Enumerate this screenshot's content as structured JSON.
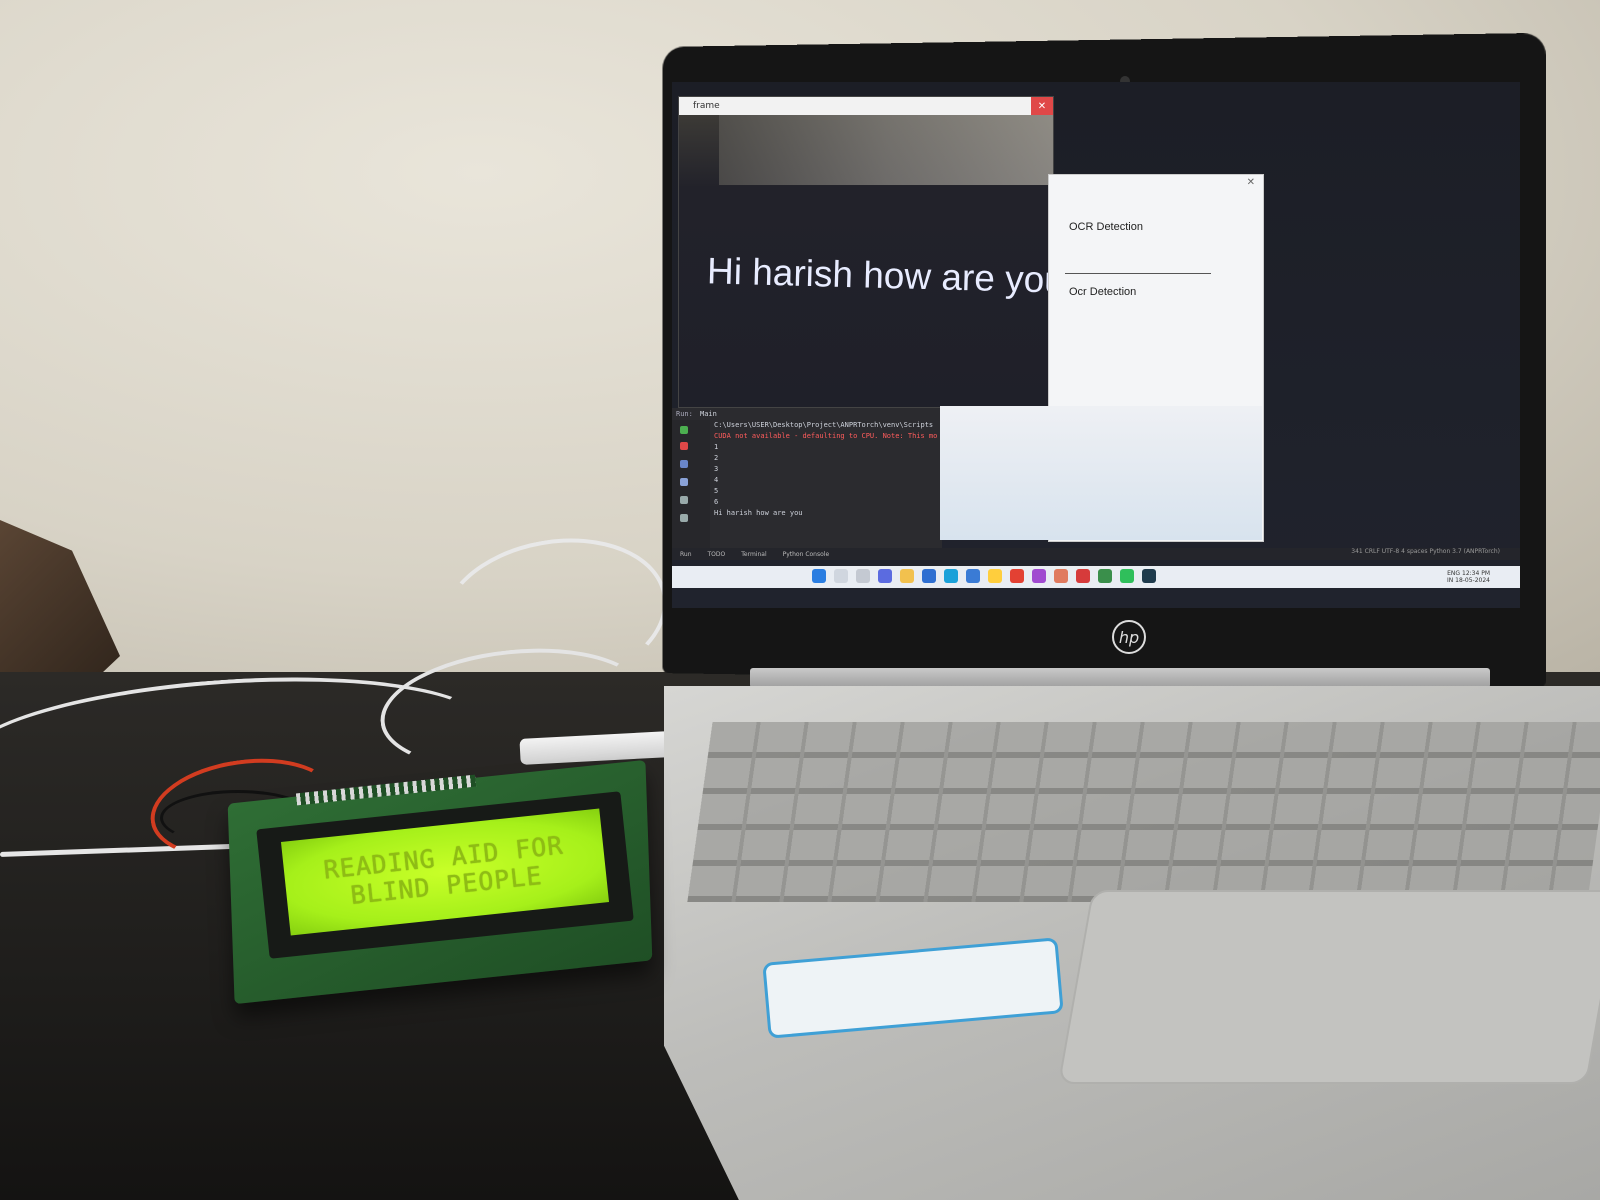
{
  "scene": {
    "laptop_brand": "hp"
  },
  "screen": {
    "frame_window": {
      "title": "frame",
      "caption": "Hi harish how are you"
    },
    "ocr_window": {
      "label": "OCR Detection",
      "button_label": "Ocr Detection"
    },
    "run_panel": {
      "header": "Run:",
      "tab": "Main",
      "console_lines": [
        "C:\\Users\\USER\\Desktop\\Project\\ANPRTorch\\venv\\Scripts",
        "CUDA not available - defaulting to CPU. Note: This mo",
        "1",
        "2",
        "3",
        "4",
        "5",
        "6",
        "Hi harish how are you"
      ]
    },
    "tool_tabs": [
      "Run",
      "TODO",
      "Terminal",
      "Python Console"
    ],
    "status_bar": "341  CRLF  UTF-8  4 spaces  Python 3.7 (ANPRTorch)",
    "tray": {
      "language": "ENG",
      "region": "IN",
      "time": "12:34 PM",
      "date": "18-05-2024"
    }
  },
  "lcd": {
    "line1": "READING AID FOR",
    "line2": "BLIND PEOPLE",
    "backlight_color": "#b8f522"
  },
  "colors": {
    "caption_text": "#e8ecff",
    "console_error": "#ff5c5c",
    "window_close": "#e04848"
  }
}
